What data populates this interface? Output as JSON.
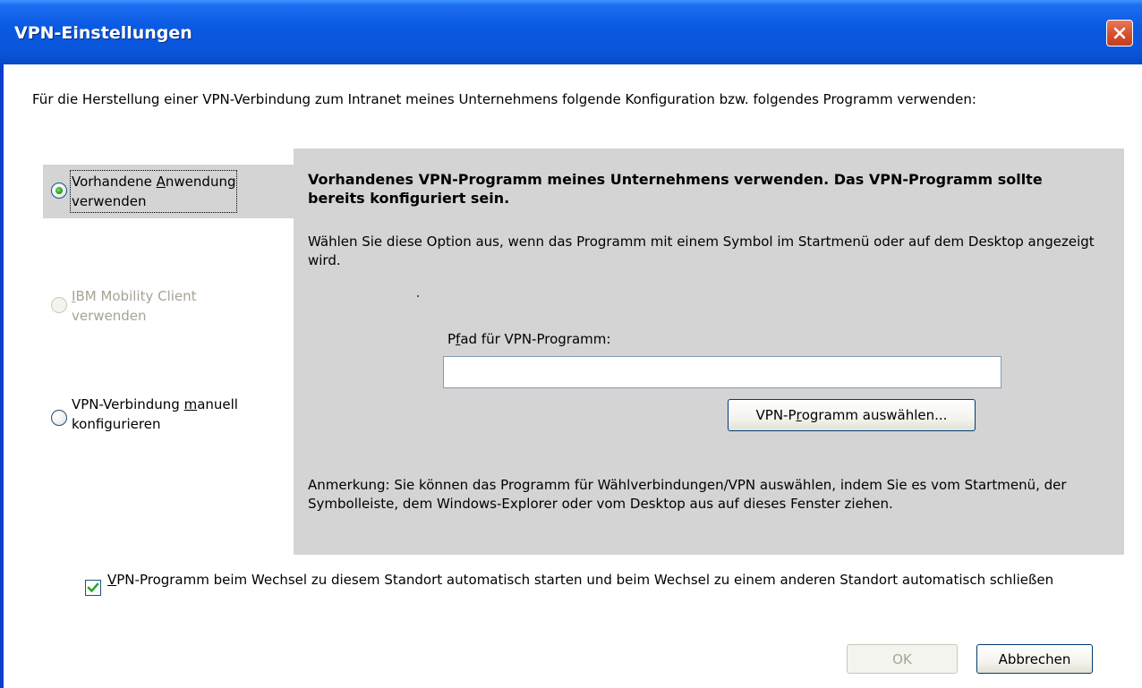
{
  "window": {
    "title": "VPN-Einstellungen"
  },
  "intro": "Für die Herstellung einer VPN-Verbindung zum Intranet meines Unternehmens folgende Konfiguration bzw. folgendes Programm verwenden:",
  "options": [
    {
      "line1_pre": "Vorhandene ",
      "line1_key": "A",
      "line1_post": "nwendung",
      "line2": "verwenden",
      "selected": true,
      "enabled": true
    },
    {
      "line1_pre": "",
      "line1_key": "I",
      "line1_post": "BM Mobility Client",
      "line2": "verwenden",
      "selected": false,
      "enabled": false
    },
    {
      "line1_pre": "VPN-Verbindung ",
      "line1_key": "m",
      "line1_post": "anuell",
      "line2": "konfigurieren",
      "selected": false,
      "enabled": true
    }
  ],
  "panel": {
    "heading": "Vorhandenes VPN-Programm meines Unternehmens verwenden. Das VPN-Programm sollte bereits konfiguriert sein.",
    "description": "Wählen Sie diese Option aus, wenn das Programm mit einem Symbol im Startmenü oder auf dem Desktop angezeigt wird.",
    "path_label_pre": "P",
    "path_label_key": "f",
    "path_label_post": "ad für VPN-Programm:",
    "path_value": "",
    "choose_pre": "VPN-P",
    "choose_key": "r",
    "choose_post": "ogramm auswählen...",
    "note": "Anmerkung: Sie können das Programm für Wählverbindungen/VPN auswählen, indem Sie es vom Startmenü, der Symbolleiste, dem Windows-Explorer oder vom Desktop aus auf dieses Fenster ziehen."
  },
  "autostart": {
    "key": "V",
    "rest": "PN-Programm beim Wechsel zu diesem Standort automatisch starten und beim Wechsel zu einem anderen Standort automatisch schließen",
    "checked": true
  },
  "buttons": {
    "ok": "OK",
    "cancel": "Abbrechen"
  },
  "colors": {
    "titlebar": "#0a55da",
    "panel": "#d4d4d4",
    "close": "#d8532f"
  },
  "icons": {
    "close": "close-icon",
    "check": "check-icon",
    "radio_dot": "radio-dot-icon"
  }
}
